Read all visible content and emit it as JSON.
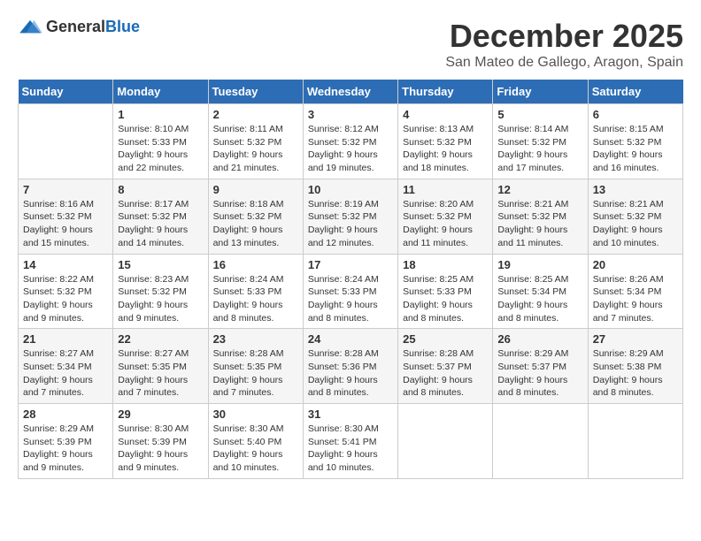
{
  "logo": {
    "text_general": "General",
    "text_blue": "Blue"
  },
  "title": "December 2025",
  "location": "San Mateo de Gallego, Aragon, Spain",
  "days_of_week": [
    "Sunday",
    "Monday",
    "Tuesday",
    "Wednesday",
    "Thursday",
    "Friday",
    "Saturday"
  ],
  "weeks": [
    [
      {
        "day": "",
        "info": ""
      },
      {
        "day": "1",
        "info": "Sunrise: 8:10 AM\nSunset: 5:33 PM\nDaylight: 9 hours\nand 22 minutes."
      },
      {
        "day": "2",
        "info": "Sunrise: 8:11 AM\nSunset: 5:32 PM\nDaylight: 9 hours\nand 21 minutes."
      },
      {
        "day": "3",
        "info": "Sunrise: 8:12 AM\nSunset: 5:32 PM\nDaylight: 9 hours\nand 19 minutes."
      },
      {
        "day": "4",
        "info": "Sunrise: 8:13 AM\nSunset: 5:32 PM\nDaylight: 9 hours\nand 18 minutes."
      },
      {
        "day": "5",
        "info": "Sunrise: 8:14 AM\nSunset: 5:32 PM\nDaylight: 9 hours\nand 17 minutes."
      },
      {
        "day": "6",
        "info": "Sunrise: 8:15 AM\nSunset: 5:32 PM\nDaylight: 9 hours\nand 16 minutes."
      }
    ],
    [
      {
        "day": "7",
        "info": "Sunrise: 8:16 AM\nSunset: 5:32 PM\nDaylight: 9 hours\nand 15 minutes."
      },
      {
        "day": "8",
        "info": "Sunrise: 8:17 AM\nSunset: 5:32 PM\nDaylight: 9 hours\nand 14 minutes."
      },
      {
        "day": "9",
        "info": "Sunrise: 8:18 AM\nSunset: 5:32 PM\nDaylight: 9 hours\nand 13 minutes."
      },
      {
        "day": "10",
        "info": "Sunrise: 8:19 AM\nSunset: 5:32 PM\nDaylight: 9 hours\nand 12 minutes."
      },
      {
        "day": "11",
        "info": "Sunrise: 8:20 AM\nSunset: 5:32 PM\nDaylight: 9 hours\nand 11 minutes."
      },
      {
        "day": "12",
        "info": "Sunrise: 8:21 AM\nSunset: 5:32 PM\nDaylight: 9 hours\nand 11 minutes."
      },
      {
        "day": "13",
        "info": "Sunrise: 8:21 AM\nSunset: 5:32 PM\nDaylight: 9 hours\nand 10 minutes."
      }
    ],
    [
      {
        "day": "14",
        "info": "Sunrise: 8:22 AM\nSunset: 5:32 PM\nDaylight: 9 hours\nand 9 minutes."
      },
      {
        "day": "15",
        "info": "Sunrise: 8:23 AM\nSunset: 5:32 PM\nDaylight: 9 hours\nand 9 minutes."
      },
      {
        "day": "16",
        "info": "Sunrise: 8:24 AM\nSunset: 5:33 PM\nDaylight: 9 hours\nand 8 minutes."
      },
      {
        "day": "17",
        "info": "Sunrise: 8:24 AM\nSunset: 5:33 PM\nDaylight: 9 hours\nand 8 minutes."
      },
      {
        "day": "18",
        "info": "Sunrise: 8:25 AM\nSunset: 5:33 PM\nDaylight: 9 hours\nand 8 minutes."
      },
      {
        "day": "19",
        "info": "Sunrise: 8:25 AM\nSunset: 5:34 PM\nDaylight: 9 hours\nand 8 minutes."
      },
      {
        "day": "20",
        "info": "Sunrise: 8:26 AM\nSunset: 5:34 PM\nDaylight: 9 hours\nand 7 minutes."
      }
    ],
    [
      {
        "day": "21",
        "info": "Sunrise: 8:27 AM\nSunset: 5:34 PM\nDaylight: 9 hours\nand 7 minutes."
      },
      {
        "day": "22",
        "info": "Sunrise: 8:27 AM\nSunset: 5:35 PM\nDaylight: 9 hours\nand 7 minutes."
      },
      {
        "day": "23",
        "info": "Sunrise: 8:28 AM\nSunset: 5:35 PM\nDaylight: 9 hours\nand 7 minutes."
      },
      {
        "day": "24",
        "info": "Sunrise: 8:28 AM\nSunset: 5:36 PM\nDaylight: 9 hours\nand 8 minutes."
      },
      {
        "day": "25",
        "info": "Sunrise: 8:28 AM\nSunset: 5:37 PM\nDaylight: 9 hours\nand 8 minutes."
      },
      {
        "day": "26",
        "info": "Sunrise: 8:29 AM\nSunset: 5:37 PM\nDaylight: 9 hours\nand 8 minutes."
      },
      {
        "day": "27",
        "info": "Sunrise: 8:29 AM\nSunset: 5:38 PM\nDaylight: 9 hours\nand 8 minutes."
      }
    ],
    [
      {
        "day": "28",
        "info": "Sunrise: 8:29 AM\nSunset: 5:39 PM\nDaylight: 9 hours\nand 9 minutes."
      },
      {
        "day": "29",
        "info": "Sunrise: 8:30 AM\nSunset: 5:39 PM\nDaylight: 9 hours\nand 9 minutes."
      },
      {
        "day": "30",
        "info": "Sunrise: 8:30 AM\nSunset: 5:40 PM\nDaylight: 9 hours\nand 10 minutes."
      },
      {
        "day": "31",
        "info": "Sunrise: 8:30 AM\nSunset: 5:41 PM\nDaylight: 9 hours\nand 10 minutes."
      },
      {
        "day": "",
        "info": ""
      },
      {
        "day": "",
        "info": ""
      },
      {
        "day": "",
        "info": ""
      }
    ]
  ]
}
